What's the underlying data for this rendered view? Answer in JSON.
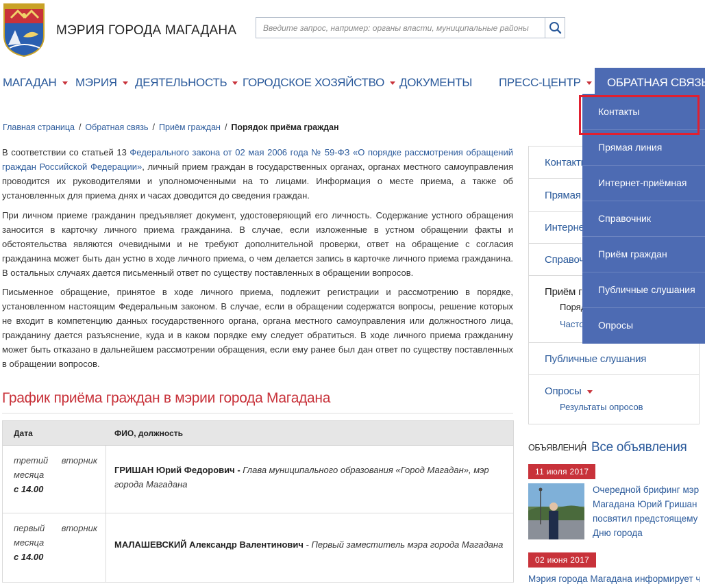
{
  "header": {
    "site_title": "МЭРИЯ ГОРОДА МАГАДАНА",
    "search_placeholder": "Введите запрос, например: органы власти, муниципальные районы",
    "search_icon": "magnifier-icon",
    "logo": "magadan-coat-of-arms"
  },
  "nav": {
    "items": [
      {
        "label": "МАГАДАН",
        "has_caret": true
      },
      {
        "label": "МЭРИЯ",
        "has_caret": true
      },
      {
        "label": "ДЕЯТЕЛЬНОСТЬ",
        "has_caret": true
      },
      {
        "label": "ГОРОДСКОЕ ХОЗЯЙСТВО",
        "has_caret": true
      },
      {
        "label": "ДОКУМЕНТЫ",
        "has_caret": false
      },
      {
        "label": "ПРЕСС-ЦЕНТР",
        "has_caret": true
      },
      {
        "label": "ОБРАТНАЯ СВЯЗЬ",
        "has_caret": true,
        "active": true
      }
    ]
  },
  "dropdown": {
    "items": [
      "Контакты",
      "Прямая линия",
      "Интернет-приёмная",
      "Справочник",
      "Приём граждан",
      "Публичные слушания",
      "Опросы"
    ],
    "highlighted": "Контакты"
  },
  "breadcrumb": {
    "items": [
      "Главная страница",
      "Обратная связь",
      "Приём граждан"
    ],
    "current": "Порядок приёма граждан"
  },
  "content": {
    "p1_before": "В соответствии со статьей 13 ",
    "p1_link": "Федерального закона от 02 мая 2006 года № 59-ФЗ «О порядке рассмотрения обращений граждан Российской Федерации»",
    "p1_after": ", личный прием граждан в государственных органах, органах местного самоуправления проводится их руководителями и уполномоченными на то лицами. Информация о месте приема, а также об установленных для приема днях и часах доводится до сведения граждан.",
    "p2": "При личном приеме гражданин предъявляет документ, удостоверяющий его личность. Содержание устного обращения заносится в карточку личного приема гражданина. В случае, если изложенные в устном обращении факты и обстоятельства являются очевидными и не требуют дополнительной проверки, ответ на обращение с согласия гражданина может быть дан устно в ходе личного приема, о чем делается запись в карточке личного приема гражданина. В остальных случаях дается письменный ответ по существу поставленных в обращении вопросов.",
    "p3": "Письменное обращение, принятое в ходе личного приема, подлежит регистрации и рассмотрению в порядке, установленном настоящим Федеральным законом. В случае, если в обращении содержатся вопросы, решение которых не входит в компетенцию данных государственного органа, органа местного самоуправления или должностного лица, гражданину дается разъяснение, куда и в каком порядке ему следует обратиться. В ходе личного приема гражданину может быть отказано в дальнейшем рассмотрении обращения, если ему ранее был дан ответ по существу поставленных в обращении вопросов.",
    "schedule_title": "График приёма граждан в мэрии города Магадана"
  },
  "table": {
    "headers": [
      "Дата",
      "ФИО, должность"
    ],
    "rows": [
      {
        "date": "третий вторник месяца",
        "time": "с 14.00",
        "name": "ГРИШАН Юрий Федорович -",
        "position": "Глава муниципального образования «Город Магадан», мэр города Магадана"
      },
      {
        "date": "первый вторник месяца",
        "time": "с 14.00",
        "name": "МАЛАШЕВСКИЙ Александр Валентинович",
        "position": "- Первый заместитель мэра города Магадана"
      }
    ]
  },
  "sidebar": {
    "items": [
      "Контакты",
      "Прямая линия",
      "Интернет-приёмная",
      "Справочник",
      "Приём граждан",
      "Публичные слушания",
      "Опросы"
    ],
    "priem_sub": [
      "Порядок приёма граждан",
      "Часто задаваемые вопросы"
    ],
    "opros_sub": "Результаты опросов"
  },
  "announcements": {
    "label": "ОБЪЯВЛЕНИЯ",
    "all_link": "Все объявления",
    "items": [
      {
        "date": "11 июля 2017",
        "text": "Очередной брифинг мэр Магадана Юрий Гришан посвятил предстоящему Дню города"
      },
      {
        "date": "02 июня 2017",
        "text": "Мэрия города Магадана информирует что"
      }
    ]
  },
  "colors": {
    "brand_blue": "#2b5a9b",
    "menu_blue": "#4d6bb3",
    "accent_red": "#c8323a",
    "highlight_red": "#e02030"
  }
}
